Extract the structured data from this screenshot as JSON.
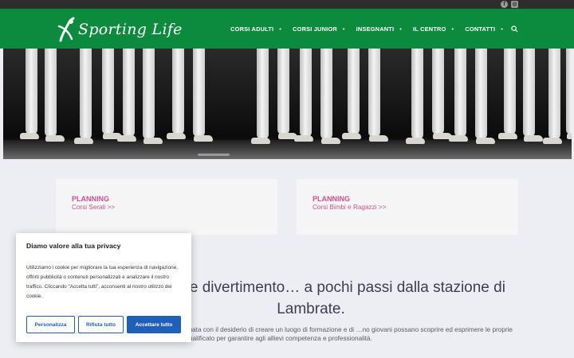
{
  "topbar": {
    "social": [
      "facebook-icon",
      "instagram-icon"
    ]
  },
  "header": {
    "logo_text": "Sporting Life",
    "nav": [
      {
        "label": "CORSI ADULTI"
      },
      {
        "label": "CORSI JUNIOR"
      },
      {
        "label": "INSEGNANTI"
      },
      {
        "label": "IL CENTRO"
      },
      {
        "label": "CONTATTI"
      }
    ]
  },
  "cards": [
    {
      "title": "PLANNING",
      "link": "Corsi Serali >>"
    },
    {
      "title": "PLANNING",
      "link": "Corsi Bimbi e Ragazzi >>"
    }
  ],
  "main": {
    "headline": "…, cultura e divertimento… a pochi passi dalla stazione di Lambrate.",
    "body": "…va e Culturale in zona Lambrate/Città Studi nata con il desiderio di creare un luogo di formazione e di …no giovani possano scoprire ed esprimere le proprie doti artistiche aiutati da personale altamente qualificato per garantire agli allievi competenza e professionalità."
  },
  "cookie": {
    "title": "Diamo valore alla tua privacy",
    "text": "Utilizziamo i cookie per migliorare la tua esperienza di navigazione, offrirti pubblicità o contenuti personalizzati e analizzare il nostro traffico. Cliccando \"Accetta tutti\", acconsenti al nostro utilizzo dei cookie.",
    "btn_customize": "Personalizza",
    "btn_reject": "Rifiuta tutto",
    "btn_accept": "Accettare tutto"
  },
  "colors": {
    "header_green": "#0c8a3e",
    "pink": "#d04f8f",
    "button_blue": "#1f5fb8"
  }
}
